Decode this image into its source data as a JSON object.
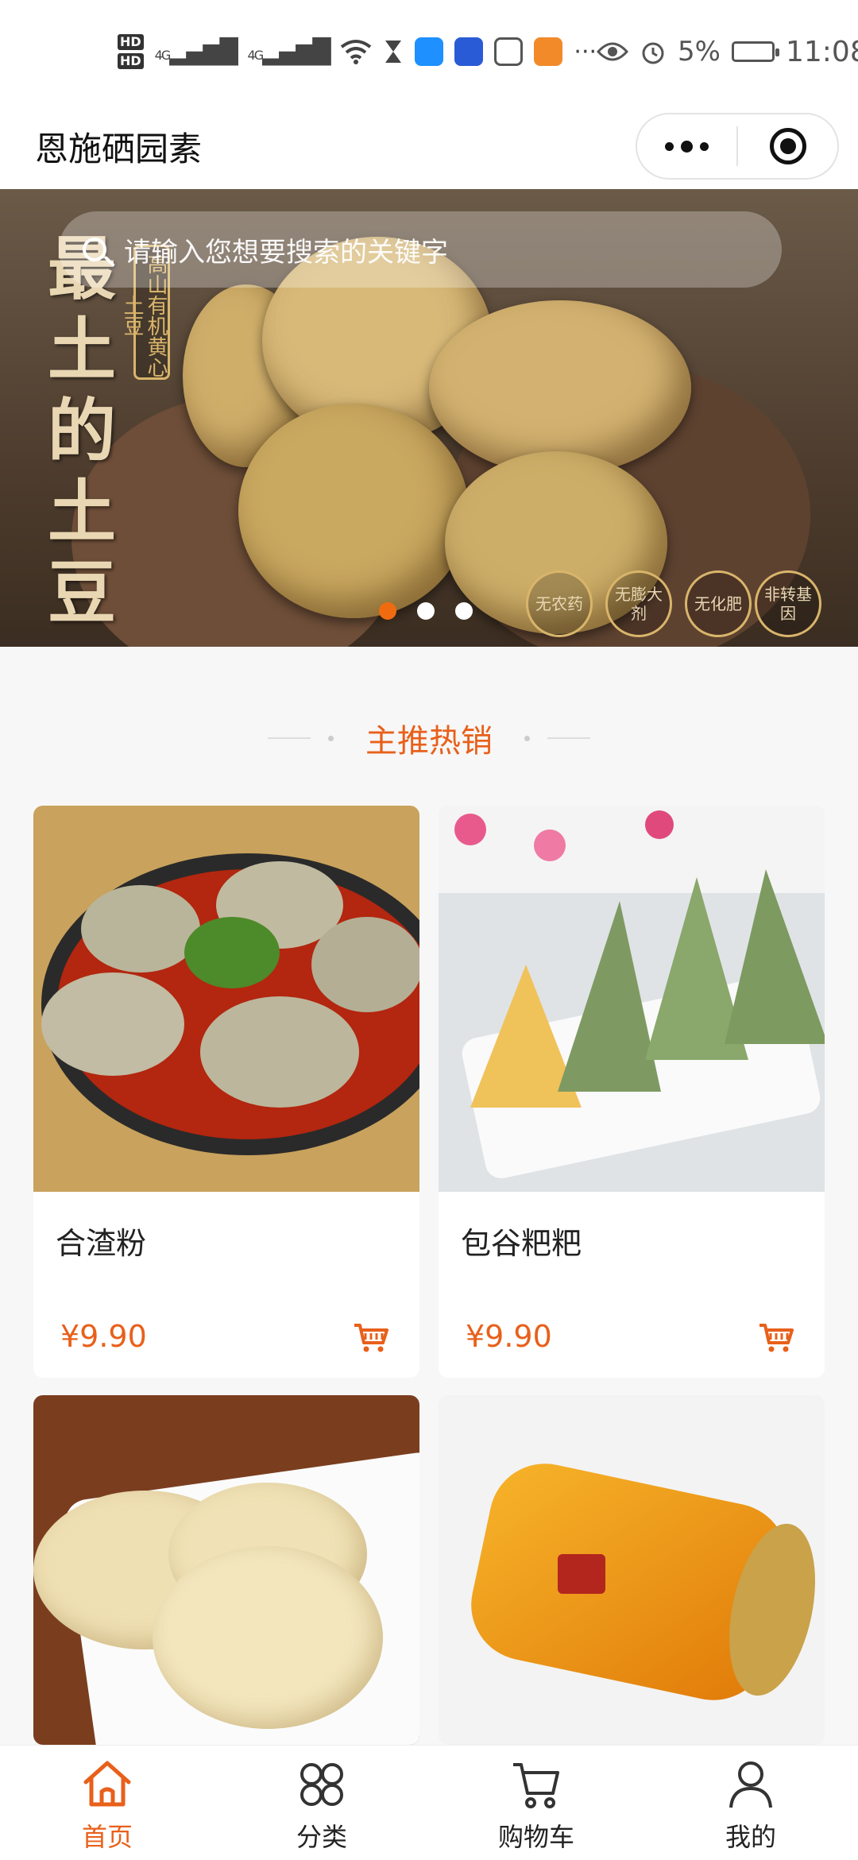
{
  "status_bar": {
    "hd1": "HD",
    "hd2": "HD",
    "net1": "4G",
    "net2": "4G",
    "more": "···",
    "battery": "5%",
    "time": "11:08"
  },
  "header": {
    "title": "恩施硒园素",
    "more_icon": "more-dots-icon",
    "close_icon": "target-circle-icon"
  },
  "banner": {
    "search_placeholder": "请输入您想要搜索的关键字",
    "headline_lines": [
      "最",
      "土",
      "的",
      "土",
      "豆"
    ],
    "tag_text": "高山有机黄心土豆",
    "badges": [
      "无农药",
      "无膨大剂",
      "无化肥",
      "非转基因"
    ],
    "pager_count": 3,
    "pager_active": 0,
    "accent_color": "#f06b10"
  },
  "section": {
    "title": "主推热销"
  },
  "products": [
    {
      "name": "合渣粉",
      "price": "¥9.90",
      "cart_icon": "cart-icon"
    },
    {
      "name": "包谷粑粑",
      "price": "¥9.90",
      "cart_icon": "cart-icon"
    },
    {
      "name": "",
      "price": "",
      "cart_icon": ""
    },
    {
      "name": "",
      "price": "",
      "cart_icon": ""
    }
  ],
  "tabbar": {
    "items": [
      {
        "label": "首页",
        "icon": "home-icon",
        "active": true
      },
      {
        "label": "分类",
        "icon": "category-icon",
        "active": false
      },
      {
        "label": "购物车",
        "icon": "cart-icon",
        "active": false
      },
      {
        "label": "我的",
        "icon": "user-icon",
        "active": false
      }
    ]
  },
  "colors": {
    "accent": "#e8601b",
    "text": "#222222"
  }
}
